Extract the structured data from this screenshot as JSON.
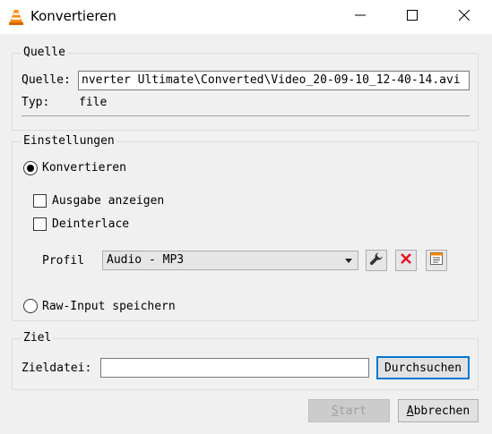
{
  "window": {
    "title": "Konvertieren",
    "app_icon": "vlc-cone-icon",
    "controls": {
      "minimize": "minimize-icon",
      "maximize": "maximize-icon",
      "close": "close-icon"
    }
  },
  "source": {
    "group_title": "Quelle",
    "source_label": "Quelle:",
    "source_value": "nverter Ultimate\\Converted\\Video_20-09-10_12-40-14.avi",
    "type_label": "Typ:",
    "type_value": "file"
  },
  "settings": {
    "group_title": "Einstellungen",
    "convert_label": "Konvertieren",
    "convert_selected": true,
    "show_output_label": "Ausgabe anzeigen",
    "show_output_checked": false,
    "deinterlace_label": "Deinterlace",
    "deinterlace_checked": false,
    "profile_label": "Profil",
    "profile_value": "Audio - MP3",
    "profile_tools": [
      "wrench-icon",
      "delete-icon",
      "new-profile-icon"
    ],
    "raw_input_label": "Raw-Input speichern",
    "raw_input_selected": false
  },
  "target": {
    "group_title": "Ziel",
    "file_label": "Zieldatei:",
    "file_value": "",
    "browse_label": "Durchsuchen"
  },
  "footer": {
    "start_label": "Start",
    "start_mnemonic": "S",
    "start_rest": "tart",
    "cancel_label": "Abbrechen",
    "cancel_mnemonic": "A",
    "cancel_rest": "bbrechen"
  },
  "colors": {
    "accent": "#0078d7",
    "delete_red": "#e81123",
    "vlc_orange": "#ff8800"
  }
}
